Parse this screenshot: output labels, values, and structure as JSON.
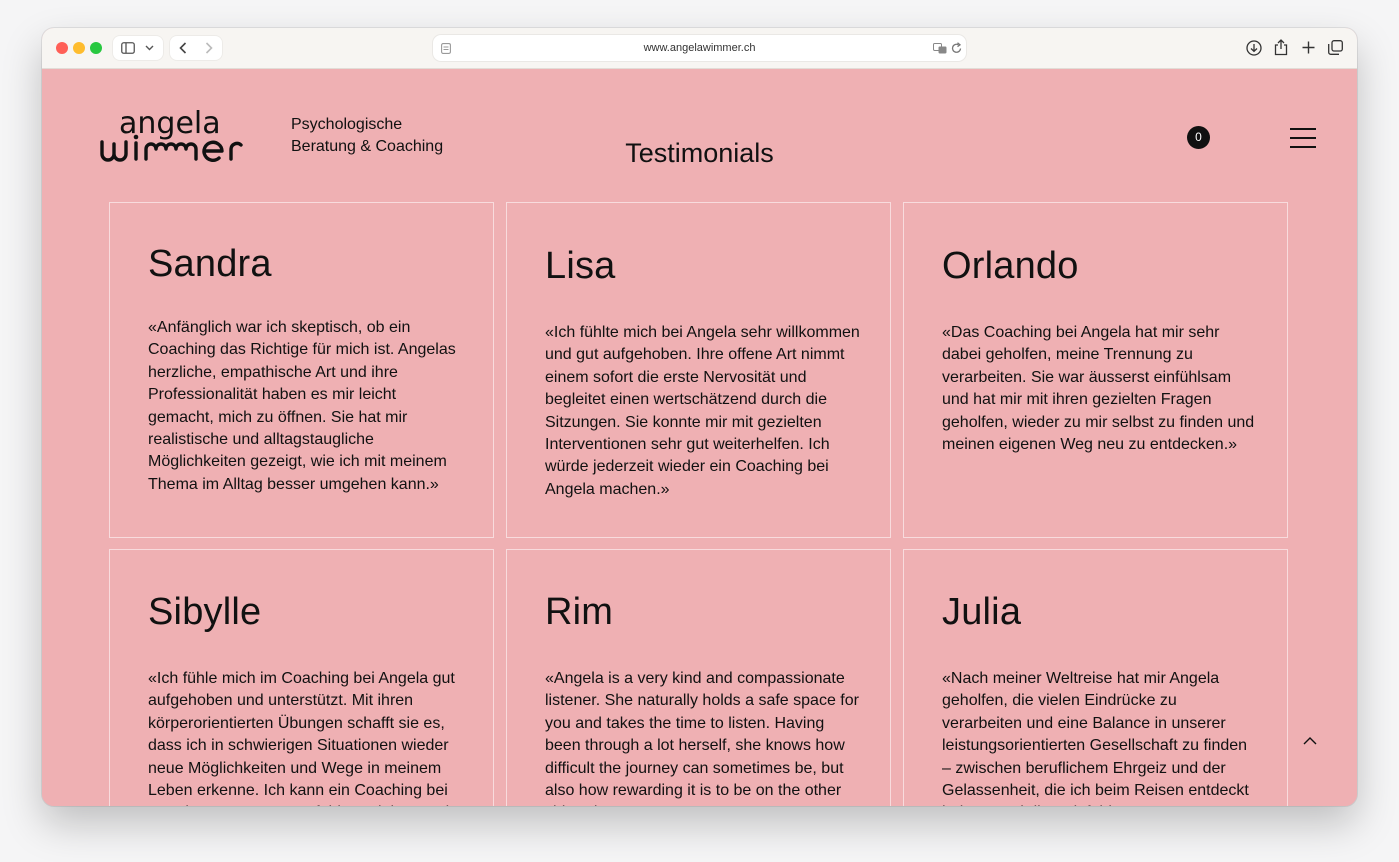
{
  "browser": {
    "url": "www.angelawimmer.ch",
    "icons": [
      "sidebar-icon",
      "chevron-down-icon",
      "back-icon",
      "forward-icon",
      "page-icon",
      "translate-icon",
      "reload-icon",
      "download-icon",
      "share-icon",
      "new-tab-icon",
      "tabs-overview-icon"
    ]
  },
  "header": {
    "logo_line1": "angela",
    "logo_line2": "wimmer",
    "tagline_line1": "Psychologische",
    "tagline_line2": "Beratung & Coaching",
    "page_title": "Testimonials",
    "cart_count": "0"
  },
  "testimonials": [
    {
      "name": "Sandra",
      "quote": "«Anfänglich war ich skeptisch, ob ein Coaching das Richtige für mich ist. Angelas herzliche, empathische Art und ihre Professionalität haben es mir leicht gemacht, mich zu öffnen. Sie hat mir realistische und alltagstaugliche Möglichkeiten gezeigt, wie ich mit meinem Thema im Alltag besser umgehen kann.»"
    },
    {
      "name": "Lisa",
      "quote": "«Ich fühlte mich bei Angela sehr willkommen und gut aufgehoben. Ihre offene Art nimmt einem sofort die erste Nervosität und begleitet einen wertschätzend durch die Sitzungen. Sie konnte mir mit gezielten Interventionen sehr gut weiterhelfen. Ich würde jederzeit wieder ein Coaching bei Angela machen.»"
    },
    {
      "name": "Orlando",
      "quote": "«Das Coaching bei Angela hat mir sehr dabei geholfen, meine Trennung zu verarbeiten. Sie war äusserst einfühlsam und hat mir mit ihren gezielten Fragen geholfen, wieder zu mir selbst zu finden und meinen eigenen Weg neu zu entdecken.»"
    },
    {
      "name": "Sibylle",
      "quote": "«Ich fühle mich im Coaching bei Angela gut aufgehoben und unterstützt. Mit ihren körperorientierten Übungen schafft sie es, dass ich in schwierigen Situationen wieder neue Möglichkeiten und Wege in meinem Leben erkenne. Ich kann ein Coaching bei Angela wärmstens empfehlen. Vielen Dank"
    },
    {
      "name": "Rim",
      "quote": "«Angela is a very kind and compassionate listener. She naturally holds a safe space for you and takes the time to listen. Having been through a lot herself, she knows how difficult the journey can sometimes be, but also how rewarding it is to be on the other side. She's"
    },
    {
      "name": "Julia",
      "quote": "«Nach meiner Weltreise hat mir Angela geholfen, die vielen Eindrücke zu verarbeiten und eine Balance in unserer leistungsorientierten Gesellschaft zu finden – zwischen beruflichem Ehrgeiz und der Gelassenheit, die ich beim Reisen entdeckt habe. Durch ihre einfühlsame Art"
    }
  ],
  "colors": {
    "page_background": "#efb0b3",
    "text": "#111111",
    "card_border": "#f6d6d7"
  }
}
